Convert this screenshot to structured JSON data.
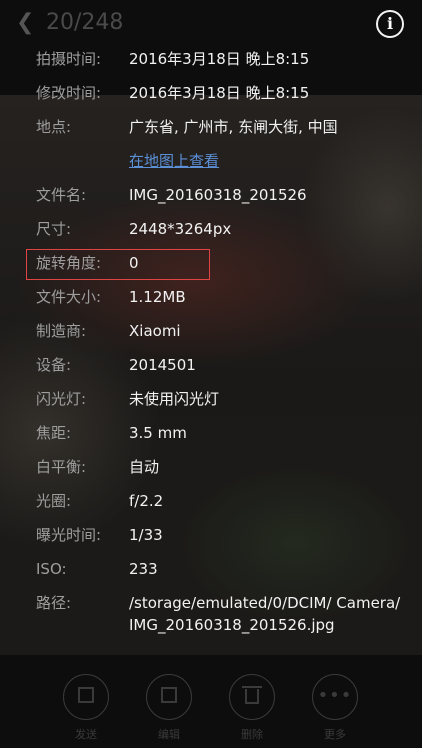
{
  "header": {
    "back_icon": "chevron-left-icon",
    "counter": "20/248",
    "info_icon": "info-icon",
    "info_glyph": "i"
  },
  "details": [
    {
      "label": "拍摄时间:",
      "value": "2016年3月18日 晚上8:15"
    },
    {
      "label": "修改时间:",
      "value": "2016年3月18日 晚上8:15"
    },
    {
      "label": "地点:",
      "value": "广东省, 广州市, 东闸大街, 中国"
    },
    {
      "label": "",
      "value": "在地图上查看"
    },
    {
      "label": "文件名:",
      "value": "IMG_20160318_201526"
    },
    {
      "label": "尺寸:",
      "value": "2448*3264px"
    },
    {
      "label": "旋转角度:",
      "value": "0"
    },
    {
      "label": "文件大小:",
      "value": "1.12MB"
    },
    {
      "label": "制造商:",
      "value": "Xiaomi"
    },
    {
      "label": "设备:",
      "value": "2014501"
    },
    {
      "label": "闪光灯:",
      "value": "未使用闪光灯"
    },
    {
      "label": "焦距:",
      "value": "3.5 mm"
    },
    {
      "label": "白平衡:",
      "value": "自动"
    },
    {
      "label": "光圈:",
      "value": "f/2.2"
    },
    {
      "label": "曝光时间:",
      "value": "1/33"
    },
    {
      "label": "ISO:",
      "value": "233"
    },
    {
      "label": "路径:",
      "value": "/storage/emulated/0/DCIM/ Camera/ IMG_20160318_201526.jpg"
    }
  ],
  "actions": [
    {
      "label": "发送",
      "icon": "share-icon"
    },
    {
      "label": "编辑",
      "icon": "edit-icon"
    },
    {
      "label": "删除",
      "icon": "trash-icon"
    },
    {
      "label": "更多",
      "icon": "more-icon"
    }
  ],
  "colors": {
    "highlight": "#e04545",
    "link": "#5b8fd6"
  }
}
